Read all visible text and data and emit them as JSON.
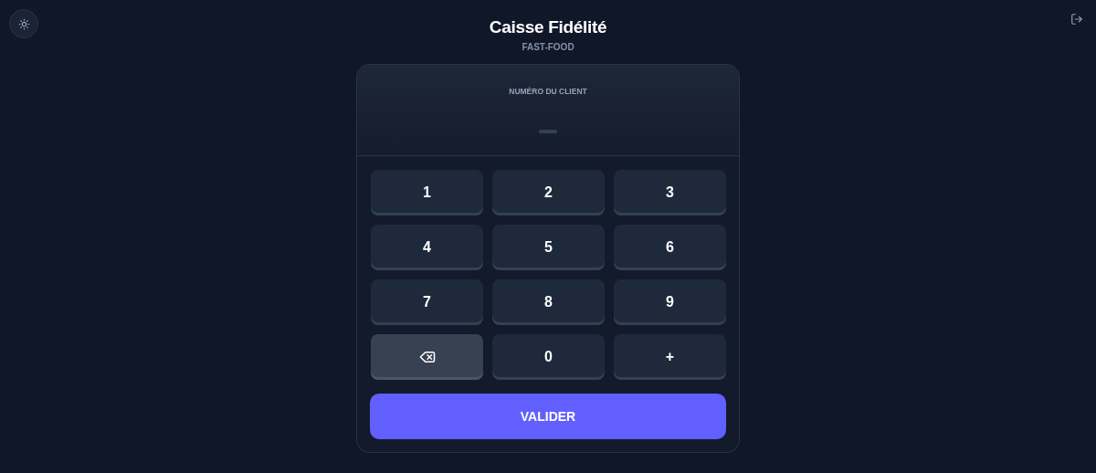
{
  "header": {
    "title": "Caisse Fidélité",
    "subtitle": "FAST-FOOD"
  },
  "display": {
    "label": "NUMÉRO DU CLIENT"
  },
  "keys": [
    {
      "kind": "digit",
      "label": "1"
    },
    {
      "kind": "digit",
      "label": "2"
    },
    {
      "kind": "digit",
      "label": "3"
    },
    {
      "kind": "digit",
      "label": "4"
    },
    {
      "kind": "digit",
      "label": "5"
    },
    {
      "kind": "digit",
      "label": "6"
    },
    {
      "kind": "digit",
      "label": "7"
    },
    {
      "kind": "digit",
      "label": "8"
    },
    {
      "kind": "digit",
      "label": "9"
    },
    {
      "kind": "backspace"
    },
    {
      "kind": "digit",
      "label": "0"
    },
    {
      "kind": "digit",
      "label": "+"
    }
  ],
  "submit": {
    "label": "VALIDER"
  }
}
